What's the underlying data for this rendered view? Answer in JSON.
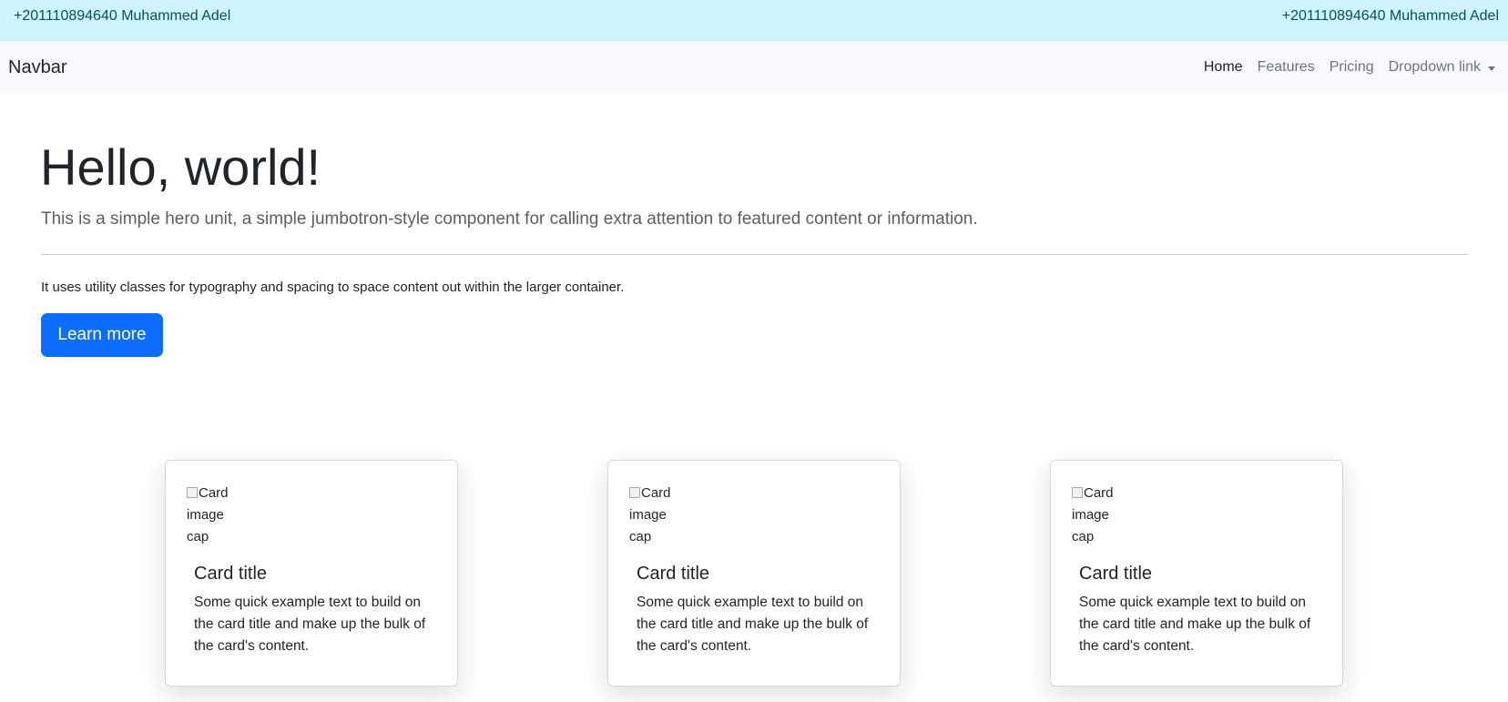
{
  "topbar": {
    "left_text": "+201110894640 Muhammed Adel",
    "right_text": "+201110894640 Muhammed Adel",
    "background": "#cff4fc"
  },
  "navbar": {
    "brand": "Navbar",
    "items": [
      {
        "label": "Home",
        "active": true
      },
      {
        "label": "Features",
        "active": false
      },
      {
        "label": "Pricing",
        "active": false
      },
      {
        "label": "Dropdown link",
        "active": false,
        "icon": "caret-down-icon"
      }
    ]
  },
  "hero": {
    "title": "Hello, world!",
    "lead": "This is a simple hero unit, a simple jumbotron-style component for calling extra attention to featured content or information.",
    "text": "It uses utility classes for typography and spacing to space content out within the larger container.",
    "button_label": "Learn more",
    "button_color": "#0d6efd"
  },
  "cards": [
    {
      "image_alt": "Card image cap",
      "title": "Card title",
      "text": "Some quick example text to build on the card title and make up the bulk of the card's content."
    },
    {
      "image_alt": "Card image cap",
      "title": "Card title",
      "text": "Some quick example text to build on the card title and make up the bulk of the card's content."
    },
    {
      "image_alt": "Card image cap",
      "title": "Card title",
      "text": "Some quick example text to build on the card title and make up the bulk of the card's content."
    }
  ]
}
